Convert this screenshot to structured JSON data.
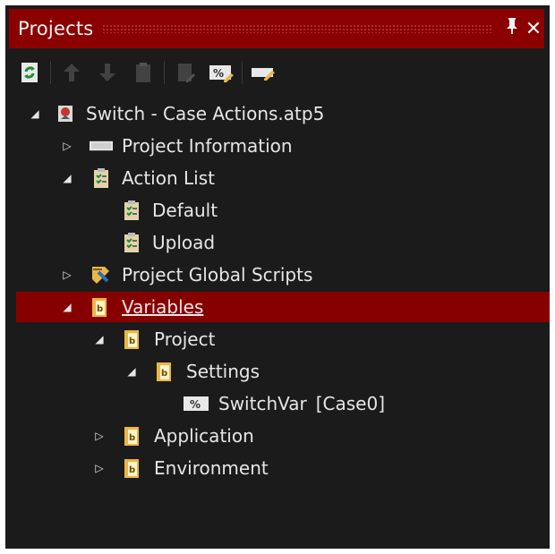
{
  "panel": {
    "title": "Projects",
    "pin_glyph": "⩘",
    "close_glyph": "✕"
  },
  "toolbar": {
    "buttons": [
      {
        "name": "refresh-icon",
        "enabled": true
      },
      {
        "name": "move-up-icon",
        "enabled": false
      },
      {
        "name": "move-down-icon",
        "enabled": false
      },
      {
        "name": "clipboard-icon",
        "enabled": false
      },
      {
        "name": "edit-document-icon",
        "enabled": false
      },
      {
        "name": "variable-percent-icon",
        "enabled": true
      },
      {
        "name": "rename-icon",
        "enabled": true
      }
    ]
  },
  "tree": {
    "root": {
      "label": "Switch - Case Actions.atp5"
    },
    "project_information": {
      "label": "Project Information"
    },
    "action_list": {
      "label": "Action List"
    },
    "default": {
      "label": "Default"
    },
    "upload": {
      "label": "Upload"
    },
    "project_global_scripts": {
      "label": "Project Global Scripts"
    },
    "variables": {
      "label": "Variables"
    },
    "project": {
      "label": "Project"
    },
    "settings": {
      "label": "Settings"
    },
    "switchvar": {
      "label": "SwitchVar",
      "value": "[Case0]"
    },
    "application": {
      "label": "Application"
    },
    "environment": {
      "label": "Environment"
    }
  },
  "colors": {
    "accent": "#8b0000",
    "selected_row": "#870000",
    "background": "#1b1b1b",
    "folder": "#e9b64a"
  }
}
